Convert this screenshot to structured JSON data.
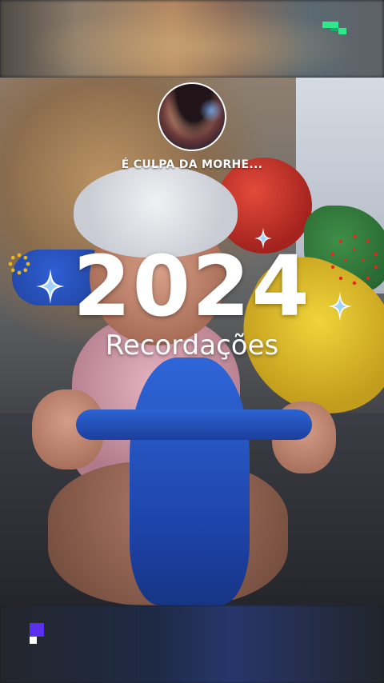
{
  "creator": {
    "name": "É CULPA DA MORHE..."
  },
  "recap": {
    "year": "2024",
    "subtitle": "Recordações"
  },
  "icons": {
    "logo_top": "pixel-logo-icon",
    "logo_bottom": "pixel-logo-icon",
    "sparkles": "sparkle-icon"
  },
  "colors": {
    "logo_green": "#2ee88a",
    "logo_purple": "#5b2ff0",
    "dot_red": "#e8281c",
    "dot_yellow": "#e8b51a"
  }
}
